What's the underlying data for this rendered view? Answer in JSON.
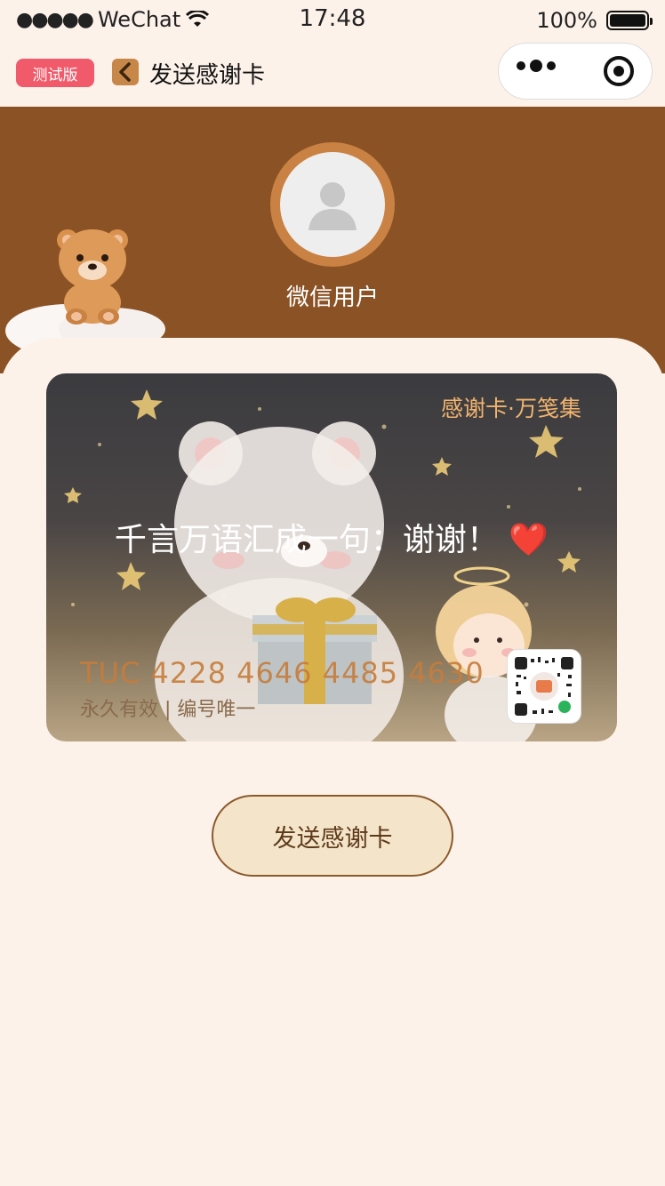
{
  "status_bar": {
    "carrier": "WeChat",
    "time": "17:48",
    "battery": "100%"
  },
  "nav": {
    "badge": "测试版",
    "title": "发送感谢卡"
  },
  "profile": {
    "name": "微信用户"
  },
  "card": {
    "brand": "感谢卡·万笺集",
    "message": "千言万语汇成一句：谢谢！",
    "message_emoji": "❤️",
    "number": "TUC 4228 4646 4485 4630",
    "validity": "永久有效 | 编号唯一"
  },
  "actions": {
    "send_label": "发送感谢卡"
  },
  "colors": {
    "header_brown": "#8b5325",
    "accent_orange": "#c98244",
    "page_bg": "#fdf2ea",
    "button_bg": "#f4e5ca"
  }
}
